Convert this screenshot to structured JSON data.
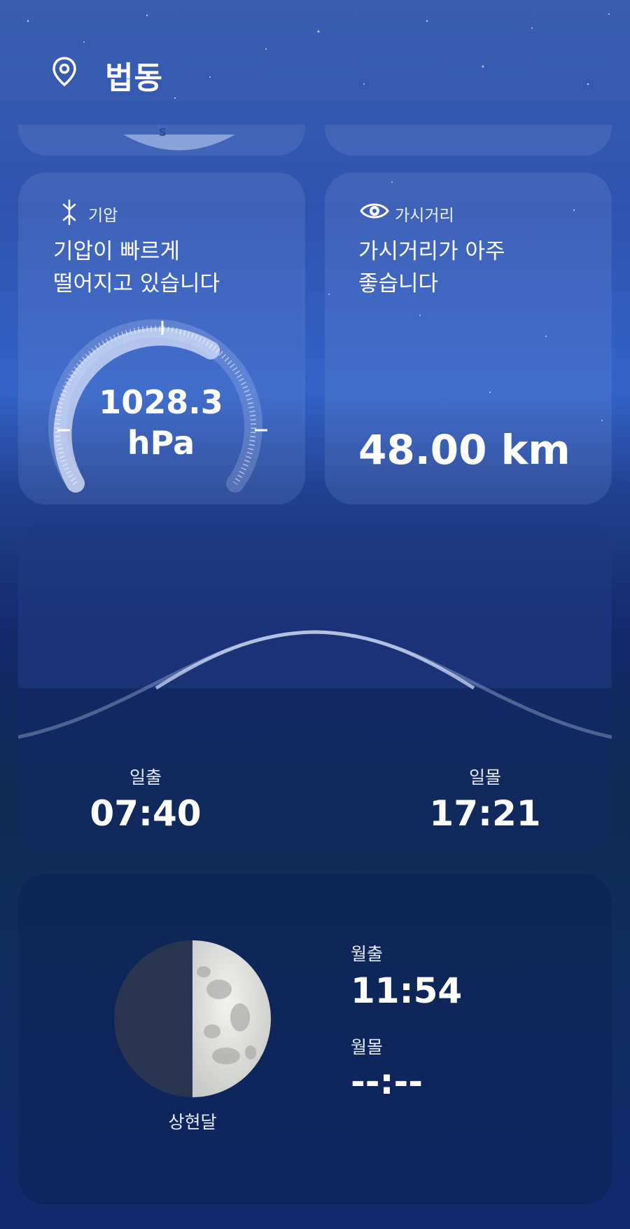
{
  "header": {
    "location": "법동",
    "icon": "location-pin-icon"
  },
  "compass_stub": {
    "direction": "S"
  },
  "pressure": {
    "label": "기압",
    "icon": "pressure-icon",
    "description_line1": "기압이 빠르게",
    "description_line2": "떨어지고 있습니다",
    "value": "1028.3",
    "unit": "hPa"
  },
  "visibility": {
    "label": "가시거리",
    "icon": "eye-icon",
    "description_line1": "가시거리가 아주",
    "description_line2": "좋습니다",
    "value": "48.00 km"
  },
  "sun": {
    "sunrise_label": "일출",
    "sunrise_time": "07:40",
    "sunset_label": "일몰",
    "sunset_time": "17:21"
  },
  "moon": {
    "phase": "상현달",
    "moonrise_label": "월출",
    "moonrise_time": "11:54",
    "moonset_label": "월몰",
    "moonset_time": "--:--"
  }
}
